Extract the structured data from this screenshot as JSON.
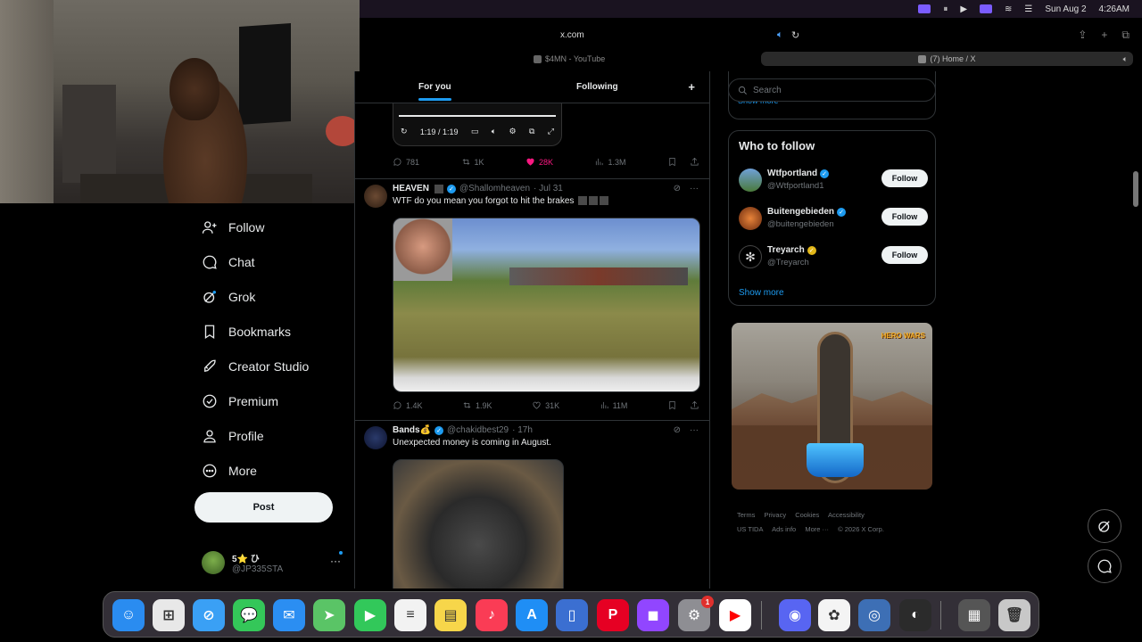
{
  "menubar": {
    "date": "Sun Aug 2",
    "time": "4:26AM"
  },
  "browser": {
    "url": "x.com",
    "tabs": [
      {
        "label": "$4MN - YouTube"
      },
      {
        "label": "(7) Home / X"
      }
    ]
  },
  "sidebar": {
    "items": [
      {
        "label": "Follow",
        "icon": "person-plus-icon"
      },
      {
        "label": "Chat",
        "icon": "chat-icon"
      },
      {
        "label": "Grok",
        "icon": "grok-icon"
      },
      {
        "label": "Bookmarks",
        "icon": "bookmark-icon"
      },
      {
        "label": "Creator Studio",
        "icon": "rocket-icon"
      },
      {
        "label": "Premium",
        "icon": "verified-icon"
      },
      {
        "label": "Profile",
        "icon": "person-icon"
      },
      {
        "label": "More",
        "icon": "more-circle-icon"
      }
    ],
    "post_label": "Post",
    "account": {
      "name": "5⭐ ひ",
      "handle": "@JP335STA"
    }
  },
  "timeline": {
    "tabs": [
      {
        "label": "For you"
      },
      {
        "label": "Following"
      }
    ],
    "video_time": "1:19 / 1:19",
    "first_actions": {
      "replies": "781",
      "reposts": "1K",
      "likes": "28K",
      "views": "1.3M"
    },
    "tweets": [
      {
        "name": "HEAVEN",
        "handle": "@Shallomheaven",
        "time": "· Jul 31",
        "text": "WTF do you mean you forgot to hit the brakes",
        "actions": {
          "replies": "1.4K",
          "reposts": "1.9K",
          "likes": "31K",
          "views": "11M"
        }
      },
      {
        "name": "Bands💰",
        "handle": "@chakidbest29",
        "time": "· 17h",
        "text": "Unexpected money is coming in August."
      }
    ]
  },
  "right": {
    "search_placeholder": "Search",
    "show_more_top": "Show more",
    "who_to_follow": "Who to follow",
    "suggestions": [
      {
        "name": "Wtfportland",
        "handle": "@Wtfportland1",
        "badge": "blue"
      },
      {
        "name": "Buitengebieden",
        "handle": "@buitengebieden",
        "badge": "blue"
      },
      {
        "name": "Treyarch",
        "handle": "@Treyarch",
        "badge": "gold"
      }
    ],
    "follow_label": "Follow",
    "show_more": "Show more",
    "ad_logo": "HERO WARS",
    "footer": [
      "Terms",
      "Privacy",
      "Cookies",
      "Accessibility",
      "US TIDA",
      "Ads info",
      "More ···",
      "© 2026 X Corp."
    ]
  },
  "dock": {
    "apps": [
      {
        "name": "Finder",
        "color": "#2a8cf0"
      },
      {
        "name": "Launchpad",
        "color": "#e8e8e8"
      },
      {
        "name": "Safari",
        "color": "#3aa0f5"
      },
      {
        "name": "Messages",
        "color": "#34c759"
      },
      {
        "name": "Mail",
        "color": "#2b8ef2"
      },
      {
        "name": "Maps",
        "color": "#5ac466"
      },
      {
        "name": "FaceTime",
        "color": "#32c85a"
      },
      {
        "name": "Reminders",
        "color": "#f2f2f2"
      },
      {
        "name": "Notes",
        "color": "#f7d64a"
      },
      {
        "name": "Music",
        "color": "#fa3c55"
      },
      {
        "name": "App Store",
        "color": "#1f8ef5"
      },
      {
        "name": "Preview",
        "color": "#3b6fd1"
      },
      {
        "name": "Pinterest",
        "color": "#e60023"
      },
      {
        "name": "Twitch",
        "color": "#9146ff"
      },
      {
        "name": "System Settings",
        "color": "#8e8e93",
        "badge": "1"
      },
      {
        "name": "YouTube",
        "color": "#ffffff"
      },
      {
        "name": "Discord",
        "color": "#5865f2"
      },
      {
        "name": "Photos",
        "color": "#f4f4f4"
      },
      {
        "name": "Capture",
        "color": "#3d6fb5"
      },
      {
        "name": "OBS",
        "color": "#2b2b2b"
      },
      {
        "name": "Downloads",
        "color": "#555555"
      },
      {
        "name": "Trash",
        "color": "#c8c8c8"
      }
    ]
  }
}
